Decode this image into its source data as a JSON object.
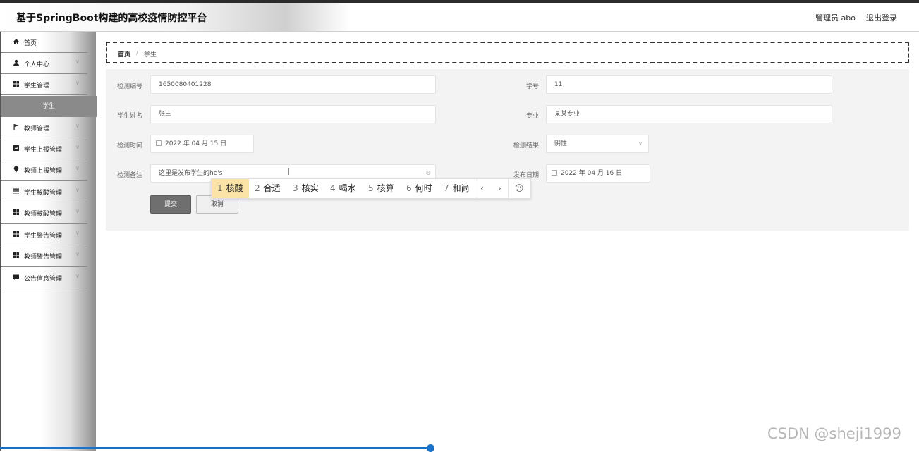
{
  "header": {
    "title": "基于SpringBoot构建的高校疫情防控平台",
    "admin": "管理员 abo",
    "logout": "退出登录"
  },
  "sidebar": {
    "items": [
      {
        "label": "首页",
        "icon": "home-icon"
      },
      {
        "label": "个人中心",
        "icon": "user-icon"
      },
      {
        "label": "学生管理",
        "icon": "grid-icon"
      },
      {
        "label": "教师管理",
        "icon": "flag-icon"
      },
      {
        "label": "学生上报管理",
        "icon": "chart-icon"
      },
      {
        "label": "教师上报管理",
        "icon": "location-icon"
      },
      {
        "label": "学生核酸管理",
        "icon": "list-icon"
      },
      {
        "label": "教师核酸管理",
        "icon": "grid-icon"
      },
      {
        "label": "学生警告管理",
        "icon": "grid-icon"
      },
      {
        "label": "教师警告管理",
        "icon": "grid-icon"
      },
      {
        "label": "公告信息管理",
        "icon": "message-icon"
      }
    ],
    "subitem": "学生"
  },
  "breadcrumb": {
    "home": "首页",
    "separator": "/",
    "current": "学生"
  },
  "form": {
    "test_no_label": "检测编号",
    "test_no_value": "1650080401228",
    "student_no_label": "学号",
    "student_no_value": "11",
    "name_label": "学生姓名",
    "name_value": "张三",
    "major_label": "专业",
    "major_value": "某某专业",
    "test_time_label": "检测时间",
    "test_time_value": "2022 年 04 月 15 日",
    "result_label": "检测结果",
    "result_value": "阴性",
    "note_label": "检测备注",
    "note_value": "这里是发布学生的he's",
    "publish_date_label": "发布日期",
    "publish_date_value": "2022 年 04 月 16 日",
    "submit": "提交",
    "cancel": "取消"
  },
  "ime": {
    "candidates": [
      {
        "num": "1",
        "text": "核酸"
      },
      {
        "num": "2",
        "text": "合适"
      },
      {
        "num": "3",
        "text": "核实"
      },
      {
        "num": "4",
        "text": "喝水"
      },
      {
        "num": "5",
        "text": "核算"
      },
      {
        "num": "6",
        "text": "何时"
      },
      {
        "num": "7",
        "text": "和尚"
      }
    ],
    "prev": "‹",
    "next": "›",
    "emoji": "☺"
  },
  "watermark": "CSDN @sheji1999",
  "colors": {
    "sidebar_active": "#8a8a8a",
    "submit_button": "#6f6f6f",
    "ime_selected": "#fbe3a8",
    "progress": "#1a73c9"
  }
}
